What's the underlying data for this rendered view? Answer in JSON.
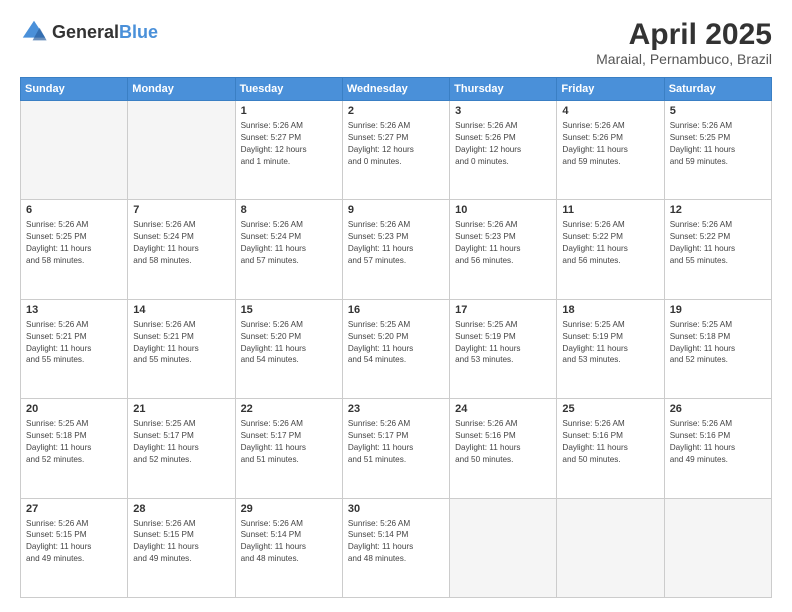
{
  "header": {
    "logo_general": "General",
    "logo_blue": "Blue",
    "title": "April 2025",
    "subtitle": "Maraial, Pernambuco, Brazil"
  },
  "weekdays": [
    "Sunday",
    "Monday",
    "Tuesday",
    "Wednesday",
    "Thursday",
    "Friday",
    "Saturday"
  ],
  "weeks": [
    [
      {
        "day": "",
        "info": ""
      },
      {
        "day": "",
        "info": ""
      },
      {
        "day": "1",
        "info": "Sunrise: 5:26 AM\nSunset: 5:27 PM\nDaylight: 12 hours\nand 1 minute."
      },
      {
        "day": "2",
        "info": "Sunrise: 5:26 AM\nSunset: 5:27 PM\nDaylight: 12 hours\nand 0 minutes."
      },
      {
        "day": "3",
        "info": "Sunrise: 5:26 AM\nSunset: 5:26 PM\nDaylight: 12 hours\nand 0 minutes."
      },
      {
        "day": "4",
        "info": "Sunrise: 5:26 AM\nSunset: 5:26 PM\nDaylight: 11 hours\nand 59 minutes."
      },
      {
        "day": "5",
        "info": "Sunrise: 5:26 AM\nSunset: 5:25 PM\nDaylight: 11 hours\nand 59 minutes."
      }
    ],
    [
      {
        "day": "6",
        "info": "Sunrise: 5:26 AM\nSunset: 5:25 PM\nDaylight: 11 hours\nand 58 minutes."
      },
      {
        "day": "7",
        "info": "Sunrise: 5:26 AM\nSunset: 5:24 PM\nDaylight: 11 hours\nand 58 minutes."
      },
      {
        "day": "8",
        "info": "Sunrise: 5:26 AM\nSunset: 5:24 PM\nDaylight: 11 hours\nand 57 minutes."
      },
      {
        "day": "9",
        "info": "Sunrise: 5:26 AM\nSunset: 5:23 PM\nDaylight: 11 hours\nand 57 minutes."
      },
      {
        "day": "10",
        "info": "Sunrise: 5:26 AM\nSunset: 5:23 PM\nDaylight: 11 hours\nand 56 minutes."
      },
      {
        "day": "11",
        "info": "Sunrise: 5:26 AM\nSunset: 5:22 PM\nDaylight: 11 hours\nand 56 minutes."
      },
      {
        "day": "12",
        "info": "Sunrise: 5:26 AM\nSunset: 5:22 PM\nDaylight: 11 hours\nand 55 minutes."
      }
    ],
    [
      {
        "day": "13",
        "info": "Sunrise: 5:26 AM\nSunset: 5:21 PM\nDaylight: 11 hours\nand 55 minutes."
      },
      {
        "day": "14",
        "info": "Sunrise: 5:26 AM\nSunset: 5:21 PM\nDaylight: 11 hours\nand 55 minutes."
      },
      {
        "day": "15",
        "info": "Sunrise: 5:26 AM\nSunset: 5:20 PM\nDaylight: 11 hours\nand 54 minutes."
      },
      {
        "day": "16",
        "info": "Sunrise: 5:25 AM\nSunset: 5:20 PM\nDaylight: 11 hours\nand 54 minutes."
      },
      {
        "day": "17",
        "info": "Sunrise: 5:25 AM\nSunset: 5:19 PM\nDaylight: 11 hours\nand 53 minutes."
      },
      {
        "day": "18",
        "info": "Sunrise: 5:25 AM\nSunset: 5:19 PM\nDaylight: 11 hours\nand 53 minutes."
      },
      {
        "day": "19",
        "info": "Sunrise: 5:25 AM\nSunset: 5:18 PM\nDaylight: 11 hours\nand 52 minutes."
      }
    ],
    [
      {
        "day": "20",
        "info": "Sunrise: 5:25 AM\nSunset: 5:18 PM\nDaylight: 11 hours\nand 52 minutes."
      },
      {
        "day": "21",
        "info": "Sunrise: 5:25 AM\nSunset: 5:17 PM\nDaylight: 11 hours\nand 52 minutes."
      },
      {
        "day": "22",
        "info": "Sunrise: 5:26 AM\nSunset: 5:17 PM\nDaylight: 11 hours\nand 51 minutes."
      },
      {
        "day": "23",
        "info": "Sunrise: 5:26 AM\nSunset: 5:17 PM\nDaylight: 11 hours\nand 51 minutes."
      },
      {
        "day": "24",
        "info": "Sunrise: 5:26 AM\nSunset: 5:16 PM\nDaylight: 11 hours\nand 50 minutes."
      },
      {
        "day": "25",
        "info": "Sunrise: 5:26 AM\nSunset: 5:16 PM\nDaylight: 11 hours\nand 50 minutes."
      },
      {
        "day": "26",
        "info": "Sunrise: 5:26 AM\nSunset: 5:16 PM\nDaylight: 11 hours\nand 49 minutes."
      }
    ],
    [
      {
        "day": "27",
        "info": "Sunrise: 5:26 AM\nSunset: 5:15 PM\nDaylight: 11 hours\nand 49 minutes."
      },
      {
        "day": "28",
        "info": "Sunrise: 5:26 AM\nSunset: 5:15 PM\nDaylight: 11 hours\nand 49 minutes."
      },
      {
        "day": "29",
        "info": "Sunrise: 5:26 AM\nSunset: 5:14 PM\nDaylight: 11 hours\nand 48 minutes."
      },
      {
        "day": "30",
        "info": "Sunrise: 5:26 AM\nSunset: 5:14 PM\nDaylight: 11 hours\nand 48 minutes."
      },
      {
        "day": "",
        "info": ""
      },
      {
        "day": "",
        "info": ""
      },
      {
        "day": "",
        "info": ""
      }
    ]
  ]
}
